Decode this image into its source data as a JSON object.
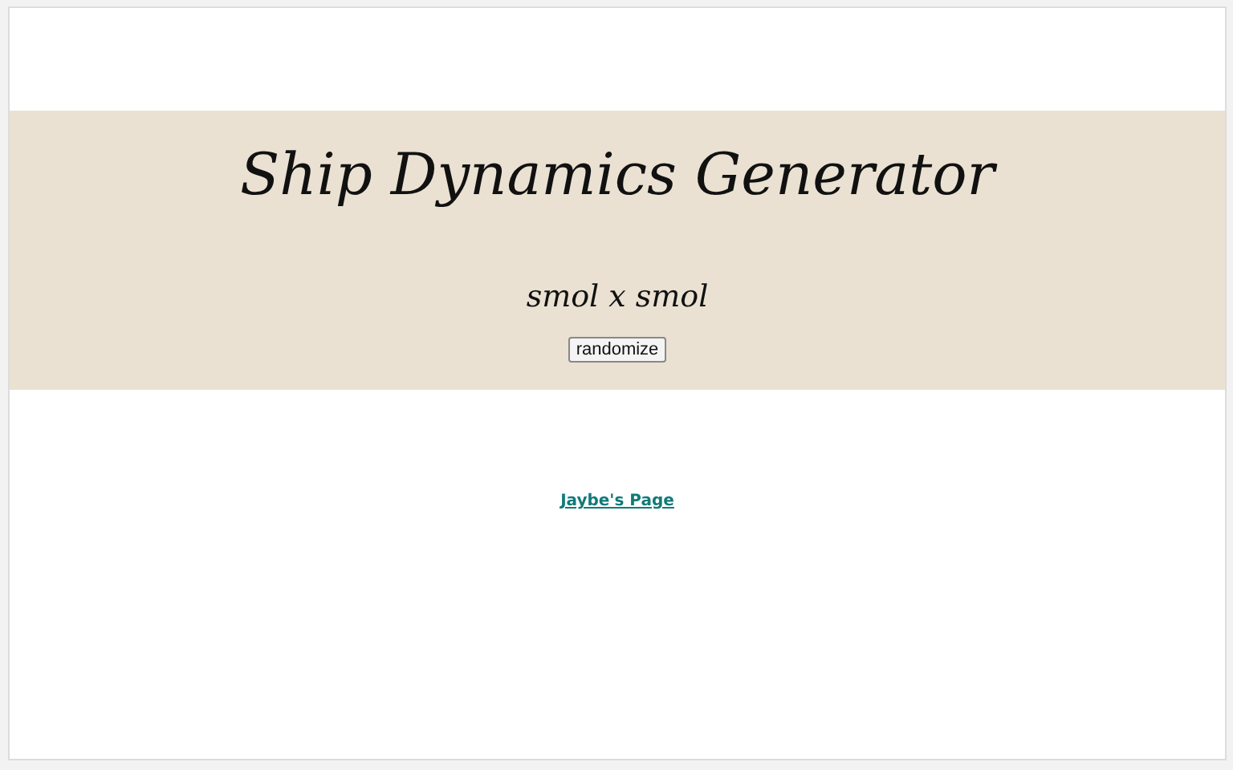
{
  "header": {
    "title": "Ship Dynamics Generator",
    "result": "smol x smol",
    "button": "randomize"
  },
  "footer": {
    "link": "Jaybe's Page"
  }
}
